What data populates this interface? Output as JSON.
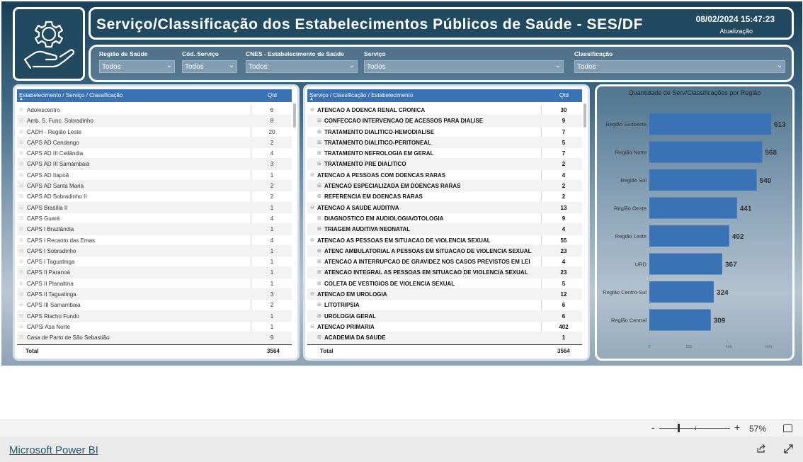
{
  "header": {
    "title": "Serviço/Classificação dos Estabelecimentos Públicos de Saúde - SES/DF",
    "datetime": "08/02/2024 15:47:23",
    "datetime_label": "Atualização"
  },
  "logo": {
    "icon": "gear-hand-icon"
  },
  "filters": [
    {
      "label": "Região de Saúde",
      "value": "Todos"
    },
    {
      "label": "Cód. Serviço",
      "value": "Todos"
    },
    {
      "label": "CNES - Estabelecimento de Saúde",
      "value": "Todos"
    },
    {
      "label": "Serviço",
      "value": "Todos"
    },
    {
      "label": "Classificação",
      "value": "Todos"
    }
  ],
  "table1": {
    "col1": "Estabelecimento / Serviço / Classificação",
    "col2": "Qtd",
    "rows": [
      {
        "label": "Adolescentro",
        "qtd": "6"
      },
      {
        "label": "Amb. S. Func. Sobradinho",
        "qtd": "8"
      },
      {
        "label": "CADH - Região Leste",
        "qtd": "20"
      },
      {
        "label": "CAPS AD Candango",
        "qtd": "2"
      },
      {
        "label": "CAPS AD III Ceilândia",
        "qtd": "4"
      },
      {
        "label": "CAPS AD III Samambaia",
        "qtd": "3"
      },
      {
        "label": "CAPS AD Itapoã",
        "qtd": "1"
      },
      {
        "label": "CAPS AD Santa Maria",
        "qtd": "2"
      },
      {
        "label": "CAPS AD Sobradinho II",
        "qtd": "2"
      },
      {
        "label": "CAPS Brasília II",
        "qtd": "1"
      },
      {
        "label": "CAPS Guará",
        "qtd": "4"
      },
      {
        "label": "CAPS I Brazlândia",
        "qtd": "1"
      },
      {
        "label": "CAPS I Recanto das Emas",
        "qtd": "4"
      },
      {
        "label": "CAPS I Sobradinho",
        "qtd": "1"
      },
      {
        "label": "CAPS I Taguatinga",
        "qtd": "1"
      },
      {
        "label": "CAPS II Paranoá",
        "qtd": "1"
      },
      {
        "label": "CAPS II Planaltina",
        "qtd": "1"
      },
      {
        "label": "CAPS II Taguatinga",
        "qtd": "3"
      },
      {
        "label": "CAPS III Samambaia",
        "qtd": "2"
      },
      {
        "label": "CAPS Riacho Fundo",
        "qtd": "1"
      },
      {
        "label": "CAPSi Asa Norte",
        "qtd": "1"
      },
      {
        "label": "Casa de Parto de São Sebastião",
        "qtd": "9"
      }
    ],
    "total_label": "Total",
    "total": "3564"
  },
  "table2": {
    "col1": "Serviço / Classificação / Estabelecimento",
    "col2": "Qtd",
    "rows": [
      {
        "label": "ATENCAO A DOENCA RENAL CRONICA",
        "qtd": "30",
        "level": 0
      },
      {
        "label": "CONFECCAO INTERVENCAO DE ACESSOS PARA DIALISE",
        "qtd": "9",
        "level": 1
      },
      {
        "label": "TRATAMENTO DIALITICO-HEMODIALISE",
        "qtd": "7",
        "level": 1
      },
      {
        "label": "TRATAMENTO DIALITICO-PERITONEAL",
        "qtd": "5",
        "level": 1
      },
      {
        "label": "TRATAMENTO NEFROLOGIA EM GERAL",
        "qtd": "7",
        "level": 1
      },
      {
        "label": "TRATAMENTO PRE DIALITICO",
        "qtd": "2",
        "level": 1
      },
      {
        "label": "ATENCAO A PESSOAS COM DOENCAS RARAS",
        "qtd": "4",
        "level": 0
      },
      {
        "label": "ATENCAO ESPECIALIZADA EM DOENCAS RARAS",
        "qtd": "2",
        "level": 1
      },
      {
        "label": "REFERENCIA EM DOENCAS RARAS",
        "qtd": "2",
        "level": 1
      },
      {
        "label": "ATENCAO A SAUDE AUDITIVA",
        "qtd": "13",
        "level": 0
      },
      {
        "label": "DIAGNOSTICO EM AUDIOLOGIA/OTOLOGIA",
        "qtd": "9",
        "level": 1
      },
      {
        "label": "TRIAGEM AUDITIVA NEONATAL",
        "qtd": "4",
        "level": 1
      },
      {
        "label": "ATENCAO AS PESSOAS EM SITUACAO DE VIOLENCIA SEXUAL",
        "qtd": "55",
        "level": 0
      },
      {
        "label": "ATENC AMBULATORIAL A PESSOAS EM SITUACAO DE VIOLENCIA SEXUAL",
        "qtd": "23",
        "level": 1
      },
      {
        "label": "ATENCAO A INTERRUPCAO DE GRAVIDEZ NOS CASOS PREVISTOS EM LEI",
        "qtd": "4",
        "level": 1
      },
      {
        "label": "ATENCAO INTEGRAL AS PESSOAS EM SITUACAO DE VIOLENCIA SEXUAL",
        "qtd": "23",
        "level": 1
      },
      {
        "label": "COLETA DE VESTIGIOS DE VIOLENCIA SEXUAL",
        "qtd": "5",
        "level": 1
      },
      {
        "label": "ATENCAO EM UROLOGIA",
        "qtd": "12",
        "level": 0
      },
      {
        "label": "LITOTRIPSIA",
        "qtd": "6",
        "level": 1
      },
      {
        "label": "UROLOGIA GERAL",
        "qtd": "6",
        "level": 1
      },
      {
        "label": "ATENCAO PRIMARIA",
        "qtd": "402",
        "level": 0
      },
      {
        "label": "ACADEMIA DA SAUDE",
        "qtd": "1",
        "level": 1
      }
    ],
    "total_label": "Total",
    "total": "3564"
  },
  "chart_data": {
    "type": "bar",
    "orientation": "horizontal",
    "title": "Quantidade de Serv/Classificações por Região",
    "categories": [
      "Região Sudoeste",
      "Região Norte",
      "Região Sul",
      "Região Oeste",
      "Região Leste",
      "URD",
      "Região Centro-Sul",
      "Região Central"
    ],
    "values": [
      613,
      568,
      540,
      441,
      402,
      367,
      324,
      309
    ],
    "xticks": [
      "0",
      "200",
      "400",
      "600"
    ],
    "xlim": [
      0,
      613
    ],
    "bar_color": "#3a73b5",
    "data_labels": true
  },
  "footer": {
    "brand": "Microsoft Power BI",
    "zoom_minus": "-",
    "zoom_plus": "+",
    "zoom": "57%",
    "zoom_level": 0.57
  }
}
